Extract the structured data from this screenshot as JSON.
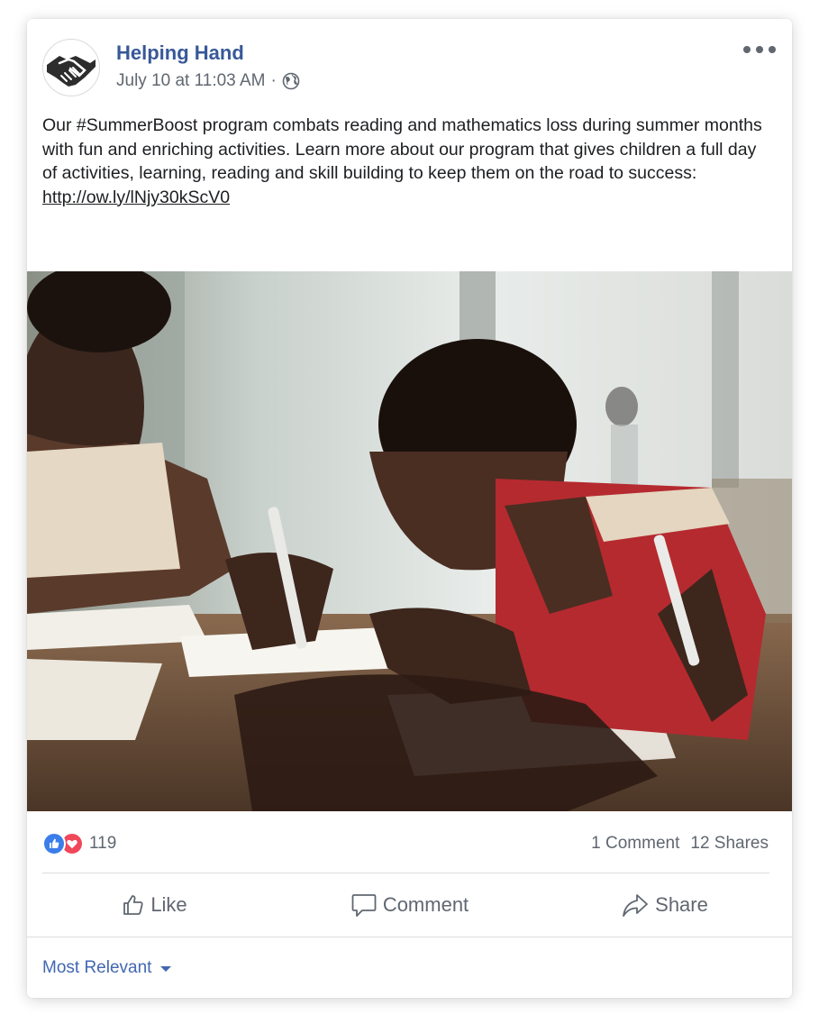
{
  "post": {
    "page_name": "Helping Hand",
    "timestamp": "July 10 at 11:03 AM",
    "separator": "·",
    "privacy_icon": "globe-icon",
    "avatar_icon": "handshake-icon",
    "body_text": "Our #SummerBoost program combats reading and mathematics loss during summer months with fun and enriching activities. Learn more about our program that gives children a full day of activities, learning, reading and skill building to keep them on the road to success: ",
    "link_text": "http://ow.ly/lNjy30kScV0"
  },
  "reactions": {
    "icons": [
      "like-icon",
      "love-icon"
    ],
    "count": "119",
    "comments": "1 Comment",
    "shares": "12 Shares"
  },
  "actions": {
    "like_label": "Like",
    "comment_label": "Comment",
    "share_label": "Share"
  },
  "comments": {
    "sort_label": "Most Relevant"
  },
  "colors": {
    "brand_link": "#385898",
    "accent_blue": "#4267b2",
    "muted_text": "#606770",
    "like_blue": "#3b7ee9",
    "love_red": "#f0485a"
  }
}
